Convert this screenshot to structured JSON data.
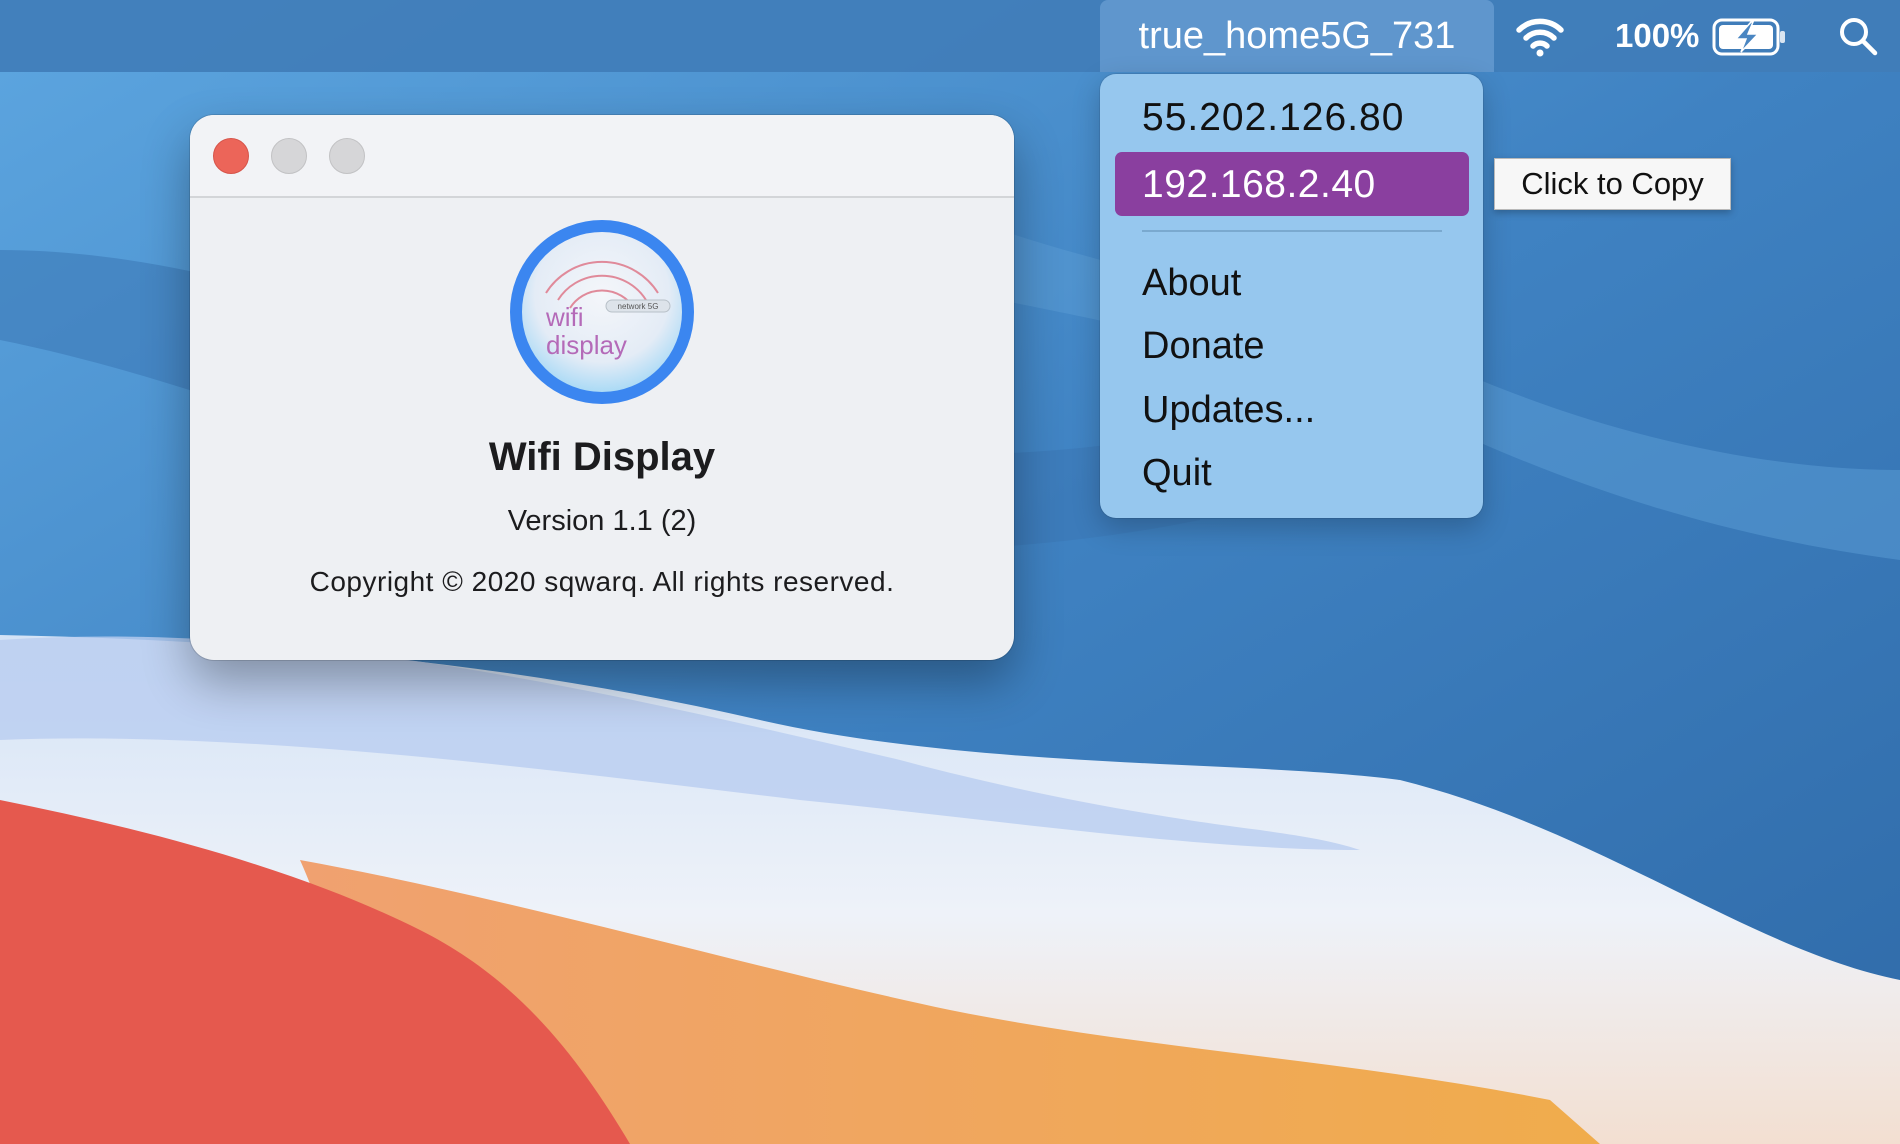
{
  "menubar": {
    "network_name": "true_home5G_731",
    "battery_percent": "100%",
    "icons": [
      "wifi-icon",
      "battery-charging-icon",
      "spotlight-search-icon"
    ]
  },
  "about_window": {
    "app_name": "Wifi Display",
    "version": "Version 1.1 (2)",
    "copyright": "Copyright © 2020 sqwarq. All rights reserved.",
    "icon": {
      "text_line1": "wifi",
      "text_line2": "display",
      "badge": "network 5G"
    }
  },
  "dropdown": {
    "public_ip": "55.202.126.80",
    "local_ip": "192.168.2.40",
    "items": [
      {
        "label": "About"
      },
      {
        "label": "Donate"
      },
      {
        "label": "Updates..."
      },
      {
        "label": "Quit"
      }
    ]
  },
  "tooltip": {
    "text": "Click to Copy"
  },
  "colors": {
    "menu_highlight": "#8a3f9f",
    "dropdown_bg": "#96c7ee",
    "close_button": "#ec6559",
    "icon_ring": "#3b86f0"
  }
}
